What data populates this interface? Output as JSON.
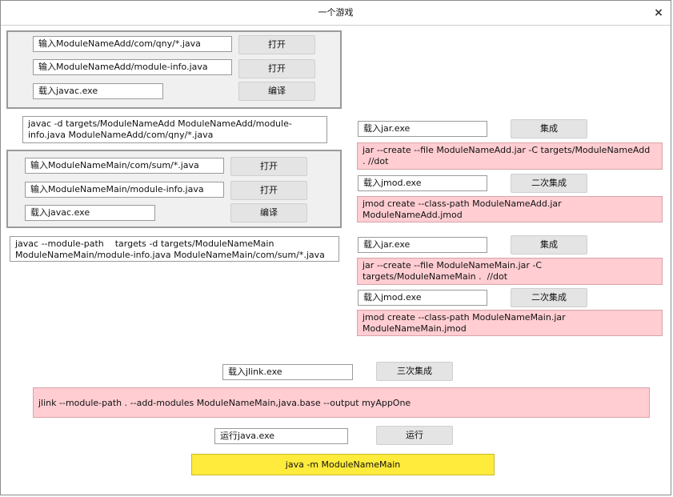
{
  "window": {
    "title": "一个游戏",
    "close_glyph": "×"
  },
  "group_add": {
    "field1": "输入ModuleNameAdd/com/qny/*.java",
    "btn1": "打开",
    "field2": "输入ModuleNameAdd/module-info.java",
    "btn2": "打开",
    "field3": "载入javac.exe",
    "btn3": "编译"
  },
  "javac_add_cmd": "javac -d targets/ModuleNameAdd ModuleNameAdd/module-\ninfo.java ModuleNameAdd/com/qny/*.java",
  "group_main": {
    "field1": "输入ModuleNameMain/com/sum/*.java",
    "btn1": "打开",
    "field2": "输入ModuleNameMain/module-info.java",
    "btn2": "打开",
    "field3": "载入javac.exe",
    "btn3": "编译"
  },
  "javac_main_cmd": "javac --module-path    targets -d targets/ModuleNameMain\nModuleNameMain/module-info.java ModuleNameMain/com/sum/*.java",
  "right_add": {
    "jar_field": "载入jar.exe",
    "jar_btn": "集成",
    "jar_cmd": "jar --create --file ModuleNameAdd.jar -C targets/ModuleNameAdd\n. //dot",
    "jmod_field": "载入jmod.exe",
    "jmod_btn": "二次集成",
    "jmod_cmd": "jmod create --class-path ModuleNameAdd.jar\nModuleNameAdd.jmod"
  },
  "right_main": {
    "jar_field": "载入jar.exe",
    "jar_btn": "集成",
    "jar_cmd": "jar --create --file ModuleNameMain.jar -C\ntargets/ModuleNameMain .  //dot",
    "jmod_field": "载入jmod.exe",
    "jmod_btn": "二次集成",
    "jmod_cmd": "jmod create --class-path ModuleNameMain.jar\nModuleNameMain.jmod"
  },
  "jlink": {
    "field": "载入jlink.exe",
    "btn": "三次集成",
    "cmd": "jlink --module-path . --add-modules ModuleNameMain,java.base --output myAppOne"
  },
  "run": {
    "field": "运行java.exe",
    "btn": "运行",
    "cmd": "java -m ModuleNameMain"
  }
}
